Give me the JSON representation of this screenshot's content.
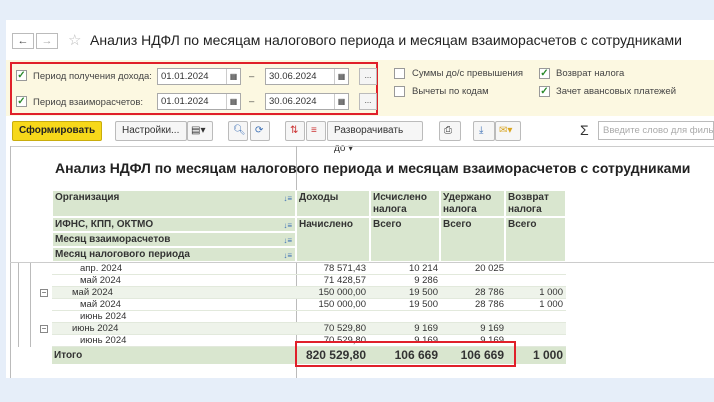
{
  "window": {
    "title": "Анализ НДФЛ по месяцам налогового периода и месяцам взаиморасчетов с сотрудниками"
  },
  "nav": {
    "back": "←",
    "forward": "→",
    "star": "☆"
  },
  "filters": {
    "income_period": {
      "label": "Период получения дохода:",
      "checked": true,
      "from": "01.01.2024",
      "to": "30.06.2024"
    },
    "settlement_period": {
      "label": "Период взаиморасчетов:",
      "checked": true,
      "from": "01.01.2024",
      "to": "30.06.2024"
    },
    "dash": "–",
    "dots": "...",
    "options": [
      {
        "label": "Суммы до/с превышения",
        "checked": false
      },
      {
        "label": "Вычеты по кодам",
        "checked": false
      },
      {
        "label": "Возврат налога",
        "checked": true
      },
      {
        "label": "Зачет авансовых платежей",
        "checked": true
      }
    ]
  },
  "toolbar": {
    "generate": "Сформировать",
    "settings": "Настройки...",
    "expand": "Разворачивать до",
    "search_placeholder": "Введите слово для фильтра",
    "sigma": "Σ"
  },
  "report": {
    "title": "Анализ НДФЛ по месяцам налогового периода и месяцам взаиморасчетов с сотрудниками",
    "row_headers": [
      "Организация",
      "ИФНС, КПП, ОКТМО",
      "Месяц взаиморасчетов",
      "Месяц налогового периода"
    ],
    "columns": [
      {
        "top": "Доходы",
        "sub": "Начислено"
      },
      {
        "top": "Исчислено налога",
        "sub": "Всего"
      },
      {
        "top": "Удержано налога",
        "sub": "Всего"
      },
      {
        "top": "Возврат налога",
        "sub": "Всего"
      }
    ],
    "rows": [
      {
        "label": "апр. 2024",
        "level": 2,
        "values": [
          "78 571,43",
          "10 214",
          "20 025",
          ""
        ]
      },
      {
        "label": "май 2024",
        "level": 2,
        "values": [
          "71 428,57",
          "9 286",
          "",
          ""
        ]
      },
      {
        "label": "май 2024",
        "level": 1,
        "values": [
          "150 000,00",
          "19 500",
          "28 786",
          "1 000"
        ]
      },
      {
        "label": "май 2024",
        "level": 2,
        "values": [
          "150 000,00",
          "19 500",
          "28 786",
          "1 000"
        ]
      },
      {
        "label": "июнь 2024",
        "level": 2,
        "values": [
          "",
          "",
          "",
          ""
        ]
      },
      {
        "label": "июнь 2024",
        "level": 1,
        "values": [
          "70 529,80",
          "9 169",
          "9 169",
          ""
        ]
      },
      {
        "label": "июнь 2024",
        "level": 2,
        "values": [
          "70 529,80",
          "9 169",
          "9 169",
          ""
        ]
      }
    ],
    "total": {
      "label": "Итого",
      "values": [
        "820 529,80",
        "106 669",
        "106 669",
        "1 000"
      ]
    }
  },
  "colors": {
    "highlight": "#e0202a",
    "header_bg": "#d9e6cf",
    "generate_bg": "#f7d81a",
    "filter_bg": "#fcf8e1"
  }
}
